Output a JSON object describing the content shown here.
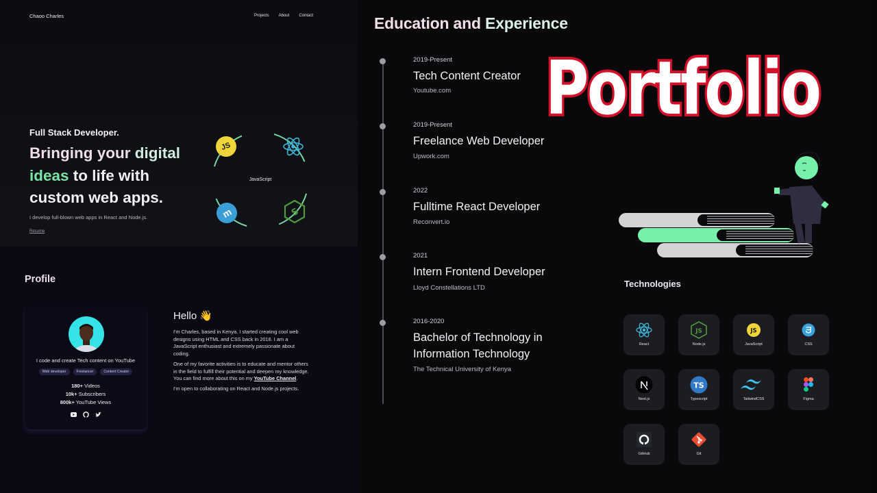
{
  "hero": {
    "brand": "Chaoo Charles",
    "nav": [
      "Projects",
      "About",
      "Contact"
    ],
    "subtitle": "Full Stack Developer.",
    "title_parts": {
      "p1": "Bringing your ",
      "p2": "digital",
      "p3": "ideas",
      "p4": " to life with",
      "p5": "custom web apps."
    },
    "description": "I develop full-blown web apps in React and Node.js.",
    "resume_link": "Resume",
    "orbit_center_label": "JavaScript",
    "orbit_icons": [
      "javascript-icon",
      "react-icon",
      "express-icon",
      "nodejs-icon"
    ]
  },
  "profile": {
    "heading": "Profile",
    "tagline": "I code and create Tech content on YouTube",
    "chips": [
      "Web developer",
      "Freelancer",
      "Content Creator"
    ],
    "stats": [
      {
        "value": "180+",
        "label": " Videos"
      },
      {
        "value": "10k+",
        "label": " Subscribers"
      },
      {
        "value": "800k+",
        "label": " YouTube Views"
      }
    ],
    "socials": [
      "youtube-icon",
      "github-icon",
      "twitter-icon"
    ],
    "hello": "Hello 👋",
    "bio": {
      "p1": "I'm Charles, based in Kenya. I started creating cool web designs using HTML and CSS back in 2016. I am a JavaScript enthusiast and extremely passionate about coding.",
      "p2_before": "One of my favorite activities is to educate and mentor others in the field to fulfill their potential and deepen my knowledge. You can find more about this on my ",
      "p2_link": "YouTube Channel",
      "p2_after": ".",
      "p3": "I'm open to collaborating on React and Node.js projects."
    }
  },
  "education": {
    "title_a": "Education and ",
    "title_b": "Experience",
    "items": [
      {
        "date": "2019-Present",
        "role": "Tech Content Creator",
        "org": "Youtube.com"
      },
      {
        "date": "2019-Present",
        "role": "Freelance Web Developer",
        "org": "Upwork.com"
      },
      {
        "date": "2022",
        "role": "Fulltime React Developer",
        "org": "Reconvert.io"
      },
      {
        "date": "2021",
        "role": "Intern Frontend Developer",
        "org": "Lloyd Constellations LTD"
      },
      {
        "date": "2016-2020",
        "role": "Bachelor of Technology in Information Technology",
        "org": "The Technical University of Kenya"
      }
    ]
  },
  "banner": {
    "text": "Portfolio",
    "fill_color": "#ffffff",
    "stroke_color": "#d4102b"
  },
  "technologies": {
    "heading": "Technologies",
    "items": [
      {
        "name": "React",
        "icon": "react-icon"
      },
      {
        "name": "Node.js",
        "icon": "nodejs-icon"
      },
      {
        "name": "JavaScript",
        "icon": "javascript-icon"
      },
      {
        "name": "CSS",
        "icon": "css-icon"
      },
      {
        "name": "Next.js",
        "icon": "nextjs-icon"
      },
      {
        "name": "Typescript",
        "icon": "typescript-icon"
      },
      {
        "name": "TailwindCSS",
        "icon": "tailwind-icon"
      },
      {
        "name": "Figma",
        "icon": "figma-icon"
      },
      {
        "name": "GitHub",
        "icon": "github-icon"
      },
      {
        "name": "Git",
        "icon": "git-icon"
      }
    ]
  },
  "colors": {
    "accent_green": "#7be3a5",
    "accent_pink": "#f1dfe8",
    "react_blue": "#3fb6d8",
    "js_yellow": "#f0d53a",
    "node_green": "#4f9a3c"
  }
}
